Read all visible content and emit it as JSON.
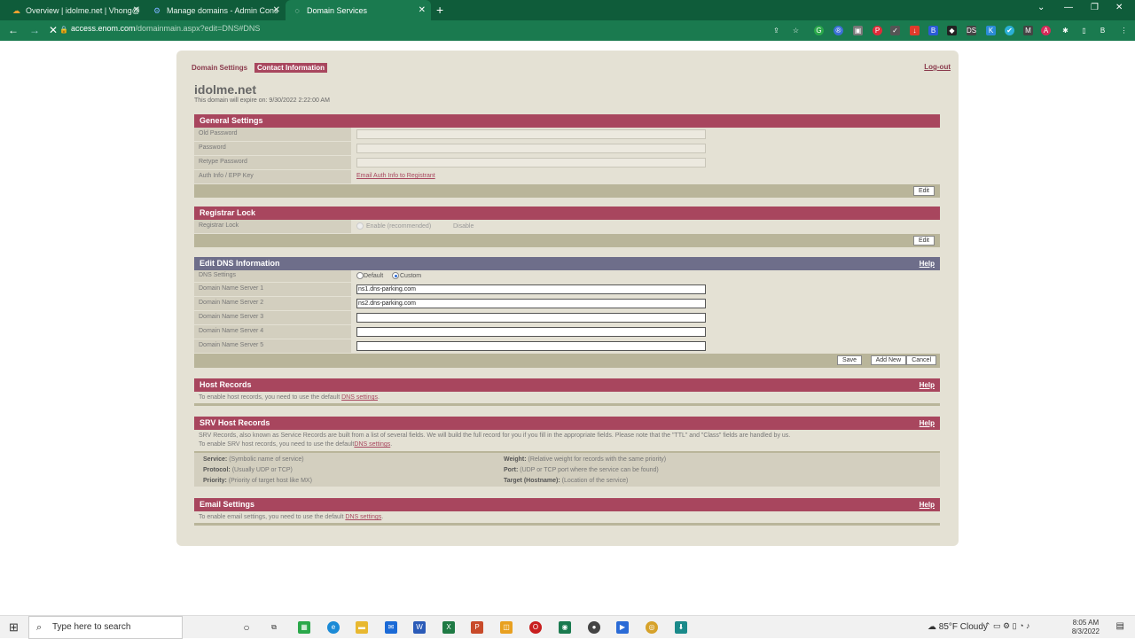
{
  "browser": {
    "tabs": [
      {
        "title": "Overview | idolme.net | Vhong@",
        "active": false
      },
      {
        "title": "Manage domains - Admin Cons",
        "active": false
      },
      {
        "title": "Domain Services",
        "active": true
      }
    ],
    "url_host": "access.enom.com",
    "url_path": "/domainmain.aspx?edit=DNS#DNS",
    "accent": "#1a7a4f"
  },
  "top_nav": {
    "domain_settings": "Domain Settings",
    "contact_information": "Contact Information",
    "logout": "Log-out"
  },
  "domain": {
    "name": "idolme.net",
    "expire_text": "This domain will expire on: 9/30/2022 2:22:00 AM"
  },
  "general": {
    "title": "General Settings",
    "old_password": "Old Password",
    "password": "Password",
    "retype_password": "Retype Password",
    "auth_info": "Auth Info / EPP Key",
    "auth_link": "Email Auth Info to Registrant",
    "edit": "Edit"
  },
  "lock": {
    "title": "Registrar Lock",
    "label": "Registrar Lock",
    "enable": "Enable (recommended)",
    "disable": "Disable",
    "edit": "Edit"
  },
  "dns": {
    "title": "Edit DNS Information",
    "help": "Help",
    "settings_label": "DNS Settings",
    "default_opt": "Default",
    "custom_opt": "Custom",
    "ns1_label": "Domain Name Server 1",
    "ns1_value": "ns1.dns-parking.com",
    "ns2_label": "Domain Name Server 2",
    "ns2_value": "ns2.dns-parking.com",
    "ns3_label": "Domain Name Server 3",
    "ns4_label": "Domain Name Server 4",
    "ns5_label": "Domain Name Server 5",
    "save": "Save",
    "add_new": "Add New",
    "cancel": "Cancel"
  },
  "host": {
    "title": "Host Records",
    "help": "Help",
    "note": "To enable host records, you need to use the default ",
    "link": "DNS settings",
    "dot": "."
  },
  "srv": {
    "title": "SRV Host Records",
    "help": "Help",
    "note1": "SRV Records, also known as Service Records are built from a list of several fields. We will build the full record for you if you fill in the appropriate fields. Please note that the \"TTL\" and \"Class\" fields are handled by us.",
    "note2": "To enable SRV host records, you need to use the default",
    "link": "DNS settings",
    "dot": ".",
    "service_k": "Service:",
    "service_v": "(Symbolic name of service)",
    "protocol_k": "Protocol:",
    "protocol_v": "(Usually UDP or TCP)",
    "priority_k": "Priority:",
    "priority_v": "(Priority of target host like MX)",
    "weight_k": "Weight:",
    "weight_v": "(Relative weight for records with the same priority)",
    "port_k": "Port:",
    "port_v": "(UDP or TCP port where the service can be found)",
    "target_k": "Target (Hostname):",
    "target_v": "(Location of the service)"
  },
  "email": {
    "title": "Email Settings",
    "help": "Help",
    "note": "To enable email settings, you need to use the default ",
    "link": "DNS settings",
    "dot": "."
  },
  "taskbar": {
    "search": "Type here to search",
    "weather": "85°F  Cloudy",
    "time": "8:05 AM",
    "date": "8/3/2022"
  }
}
